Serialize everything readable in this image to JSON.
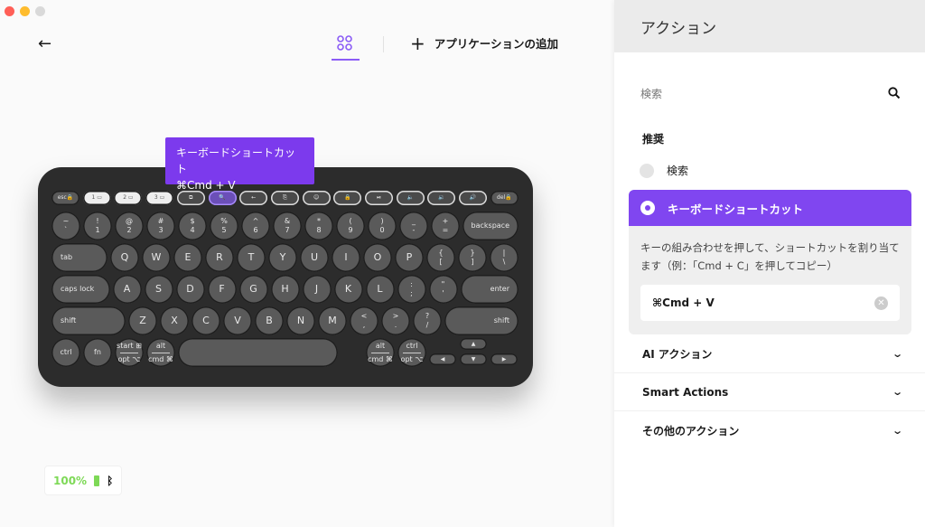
{
  "window": {
    "controls": {
      "close_color": "#ff5f57",
      "minimize_color": "#febc2e",
      "zoom_color": "#d9d9d9"
    }
  },
  "toolbar": {
    "back_icon": "arrow-left",
    "tab_icon": "four-circles",
    "add_app_icon": "plus",
    "add_app_label": "アプリケーションの追加",
    "accent": "#8b5cf6"
  },
  "tooltip": {
    "title": "キーボードショートカット",
    "value": "⌘Cmd + V"
  },
  "keyboard": {
    "fn_row": [
      "esc🔒",
      "1 ▭",
      "2 ▭",
      "3 ▭",
      "⧉",
      "🔍",
      "←",
      "⎘",
      "☺",
      "🔒",
      "⏯",
      "🔈",
      "🔉",
      "🔊",
      "del🔒"
    ],
    "rows": [
      [
        [
          "~",
          "`"
        ],
        [
          "!",
          "1"
        ],
        [
          "@",
          "2"
        ],
        [
          "#",
          "3"
        ],
        [
          "$",
          "4"
        ],
        [
          "%",
          "5"
        ],
        [
          "^",
          "6"
        ],
        [
          "&",
          "7"
        ],
        [
          "*",
          "8"
        ],
        [
          "(",
          "9"
        ],
        [
          ")",
          "0"
        ],
        [
          "_",
          "-"
        ],
        [
          "+",
          "="
        ],
        [
          "backspace",
          ""
        ]
      ],
      [
        [
          "tab",
          ""
        ],
        [
          "Q",
          ""
        ],
        [
          "W",
          ""
        ],
        [
          "E",
          ""
        ],
        [
          "R",
          ""
        ],
        [
          "T",
          ""
        ],
        [
          "Y",
          ""
        ],
        [
          "U",
          ""
        ],
        [
          "I",
          ""
        ],
        [
          "O",
          ""
        ],
        [
          "P",
          ""
        ],
        [
          "{",
          "["
        ],
        [
          "}",
          "]"
        ],
        [
          "|",
          "\\"
        ]
      ],
      [
        [
          "caps lock",
          ""
        ],
        [
          "A",
          ""
        ],
        [
          "S",
          ""
        ],
        [
          "D",
          ""
        ],
        [
          "F",
          ""
        ],
        [
          "G",
          ""
        ],
        [
          "H",
          ""
        ],
        [
          "J",
          ""
        ],
        [
          "K",
          ""
        ],
        [
          "L",
          ""
        ],
        [
          ":",
          ";"
        ],
        [
          "\"",
          "'"
        ],
        [
          "enter",
          ""
        ]
      ],
      [
        [
          "shift",
          ""
        ],
        [
          "Z",
          ""
        ],
        [
          "X",
          ""
        ],
        [
          "C",
          ""
        ],
        [
          "V",
          ""
        ],
        [
          "B",
          ""
        ],
        [
          "N",
          ""
        ],
        [
          "M",
          ""
        ],
        [
          "<",
          ","
        ],
        [
          ">",
          "."
        ],
        [
          "?",
          "/"
        ],
        [
          "shift",
          ""
        ]
      ]
    ],
    "bottom": [
      [
        "ctrl",
        ""
      ],
      [
        "fn",
        ""
      ],
      [
        "start ⊞",
        "opt ⌥"
      ],
      [
        "alt",
        "cmd ⌘"
      ],
      [
        "",
        ""
      ],
      [
        "alt",
        "cmd ⌘"
      ],
      [
        "ctrl",
        "opt ⌥"
      ]
    ],
    "arrows": [
      "▲",
      "◀",
      "▼",
      "▶"
    ]
  },
  "battery": {
    "percent": "100%",
    "level": 1.0,
    "color": "#7ed957",
    "connection_icon": "bluetooth"
  },
  "panel": {
    "title": "アクション",
    "search_placeholder": "検索",
    "recommended_label": "推奨",
    "options": [
      {
        "label": "検索",
        "selected": false
      },
      {
        "label": "キーボードショートカット",
        "selected": true
      }
    ],
    "selected_description": "キーの組み合わせを押して、ショートカットを割り当てます（例：「Cmd + C」を押してコピー）",
    "shortcut_value": "⌘Cmd + V",
    "accent": "#8046f0",
    "sections": [
      "AI アクション",
      "Smart Actions",
      "その他のアクション"
    ]
  }
}
